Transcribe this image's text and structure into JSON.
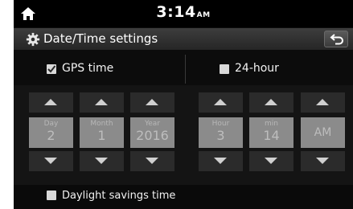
{
  "status": {
    "time": "3:14",
    "ampm": "AM"
  },
  "header": {
    "title": "Date/Time settings"
  },
  "options": {
    "gps_time": {
      "label": "GPS time",
      "checked": true
    },
    "hour24": {
      "label": "24-hour",
      "checked": false
    }
  },
  "date": {
    "day": {
      "label": "Day",
      "value": "2"
    },
    "month": {
      "label": "Month",
      "value": "1"
    },
    "year": {
      "label": "Year",
      "value": "2016"
    }
  },
  "time": {
    "hour": {
      "label": "Hour",
      "value": "3"
    },
    "min": {
      "label": "min",
      "value": "14"
    },
    "ampm": {
      "value": "AM"
    }
  },
  "daylight": {
    "label": "Daylight savings time",
    "checked": false
  },
  "icons": {
    "home": "home-icon",
    "settings": "gear-icon",
    "back": "back-arrow-icon",
    "up": "triangle-up-icon",
    "down": "triangle-down-icon"
  }
}
